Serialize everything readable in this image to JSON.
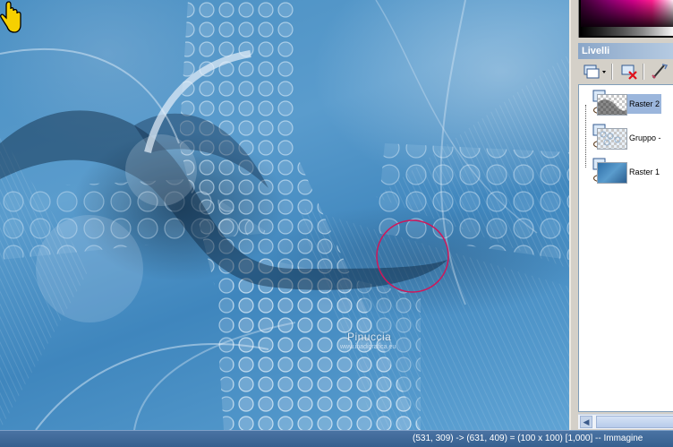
{
  "canvas": {
    "watermark_name": "Pinuccia",
    "watermark_url": "www.inadigrafica.eu"
  },
  "layers_panel": {
    "title": "Livelli",
    "layers": [
      {
        "name": "Raster 2",
        "selected": true,
        "thumb": "checker-dark"
      },
      {
        "name": "Gruppo -",
        "selected": false,
        "thumb": "checker-light"
      },
      {
        "name": "Raster 1",
        "selected": false,
        "thumb": "blue"
      }
    ],
    "toolbar_icons": [
      "new-layer-icon",
      "delete-layer-icon",
      "edit-layer-icon"
    ]
  },
  "status_bar": {
    "text": "(531, 309) -> (631, 409) = (100 x 100) [1,000] -- Immagine"
  },
  "colors": {
    "selection_circle": "#d0165a",
    "status_bar_bg": "#3d6797",
    "panel_title_bg": "#9bb4d4"
  }
}
